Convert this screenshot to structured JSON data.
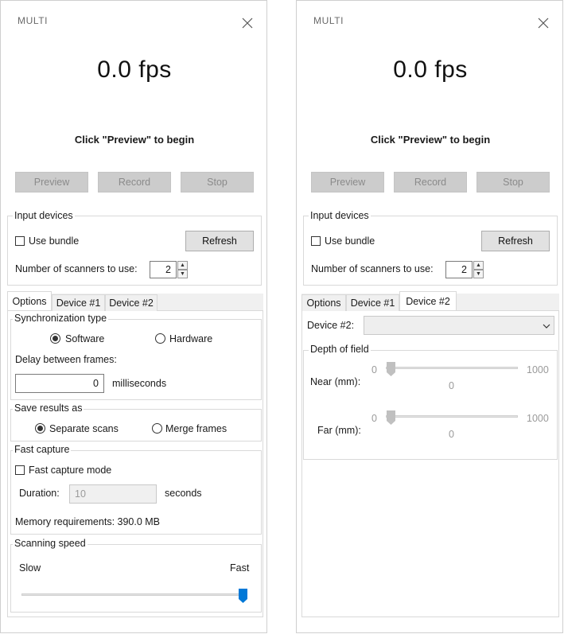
{
  "left": {
    "title": "MULTI",
    "fps": "0.0 fps",
    "hint": "Click \"Preview\" to begin",
    "buttons": {
      "preview": "Preview",
      "record": "Record",
      "stop": "Stop"
    },
    "input_devices": {
      "legend": "Input devices",
      "use_bundle": "Use bundle",
      "refresh": "Refresh",
      "scanners_label": "Number of scanners to use:",
      "scanners_value": "2"
    },
    "tabs": [
      "Options",
      "Device #1",
      "Device #2"
    ],
    "sync": {
      "legend": "Synchronization type",
      "software": "Software",
      "hardware": "Hardware",
      "delay_label": "Delay between frames:",
      "delay_value": "0",
      "delay_unit": "milliseconds"
    },
    "save": {
      "legend": "Save results as",
      "separate": "Separate scans",
      "merge": "Merge frames"
    },
    "fast": {
      "legend": "Fast capture",
      "mode": "Fast capture mode",
      "duration_label": "Duration:",
      "duration_value": "10",
      "duration_unit": "seconds",
      "memory": "Memory requirements: 390.0 MB"
    },
    "speed": {
      "legend": "Scanning speed",
      "slow": "Slow",
      "fast": "Fast",
      "level": 1.0
    }
  },
  "right": {
    "title": "MULTI",
    "fps": "0.0 fps",
    "hint": "Click \"Preview\" to begin",
    "buttons": {
      "preview": "Preview",
      "record": "Record",
      "stop": "Stop"
    },
    "input_devices": {
      "legend": "Input devices",
      "use_bundle": "Use bundle",
      "refresh": "Refresh",
      "scanners_label": "Number of scanners to use:",
      "scanners_value": "2"
    },
    "tabs": [
      "Options",
      "Device #1",
      "Device #2"
    ],
    "device": {
      "label": "Device #2:",
      "value": ""
    },
    "depth": {
      "legend": "Depth of field",
      "near_label": "Near (mm):",
      "far_label": "Far (mm):",
      "min": "0",
      "max": "1000",
      "near_value": "0",
      "far_value": "0"
    }
  },
  "colors": {
    "accent": "#0078d7",
    "disabled_button": "#cccccc",
    "tab_strip": "#f0f0f0"
  }
}
